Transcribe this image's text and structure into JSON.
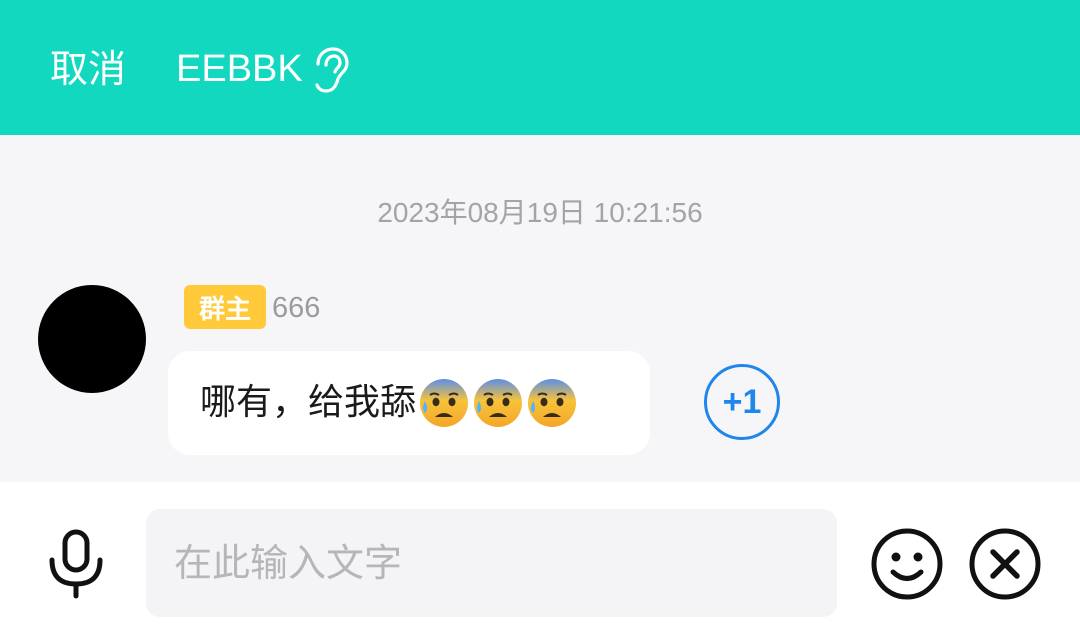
{
  "header": {
    "cancel_label": "取消",
    "title": "EEBBK",
    "background_color": "#13d8c0"
  },
  "chat": {
    "timestamp": "2023年08月19日 10:21:56",
    "message": {
      "role_badge": "群主",
      "sender_name": "666",
      "text": "哪有，给我舔",
      "emojis": [
        "anxious-face-with-sweat",
        "anxious-face-with-sweat",
        "anxious-face-with-sweat"
      ]
    },
    "plus_one_label": "+1"
  },
  "input_bar": {
    "placeholder": "在此输入文字",
    "icons": [
      "microphone-icon",
      "smile-icon",
      "close-icon"
    ]
  },
  "colors": {
    "accent": "#13d8c0",
    "badge": "#ffc93a",
    "link_blue": "#1f86ec"
  }
}
